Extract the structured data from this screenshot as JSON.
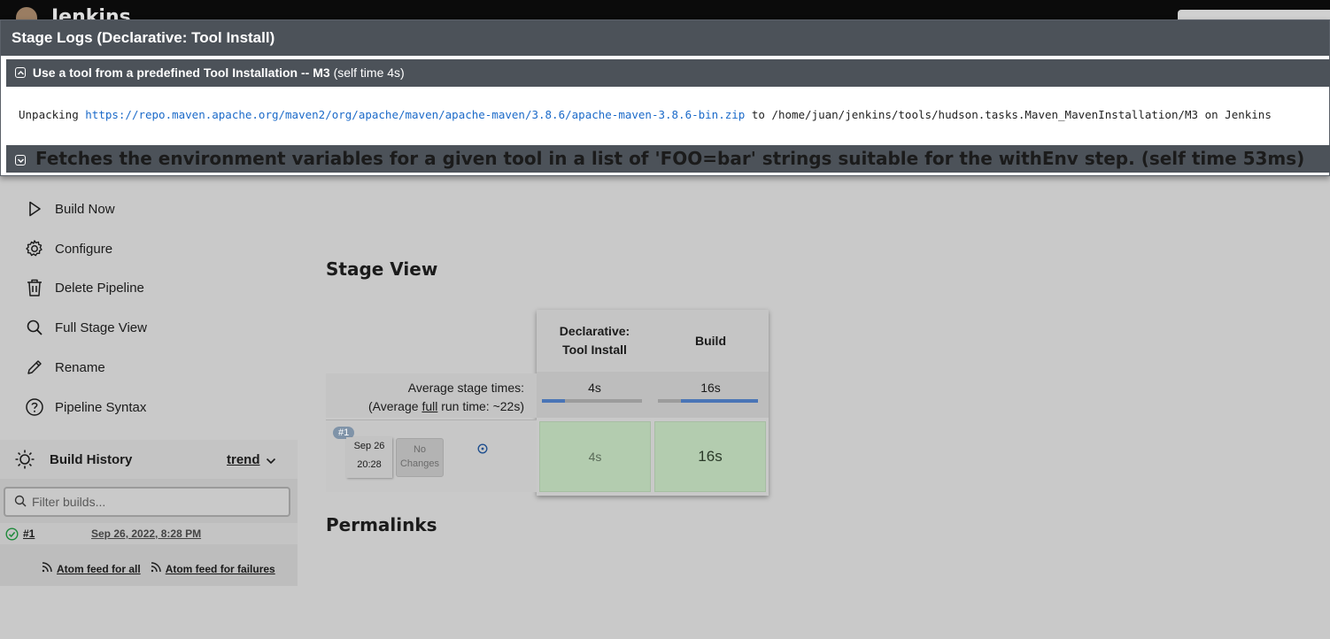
{
  "header": {
    "brand": "Jenkins"
  },
  "modal": {
    "title": "Stage Logs (Declarative: Tool Install)",
    "steps": [
      {
        "title": "Use a tool from a predefined Tool Installation -- M3",
        "time": "(self time 4s)",
        "expanded": true
      },
      {
        "title": "Fetches the environment variables for a given tool in a list of 'FOO=bar' strings suitable for the withEnv step.",
        "time": "(self time 53ms)",
        "expanded": false
      }
    ],
    "log": {
      "prefix": "Unpacking",
      "url": "https://repo.maven.apache.org/maven2/org/apache/maven/apache-maven/3.8.6/apache-maven-3.8.6-bin.zip",
      "suffix": "to /home/juan/jenkins/tools/hudson.tasks.Maven_MavenInstallation/M3 on Jenkins"
    }
  },
  "sidebar": {
    "items": [
      {
        "label": "Build Now",
        "icon": "play-icon"
      },
      {
        "label": "Configure",
        "icon": "gear-icon"
      },
      {
        "label": "Delete Pipeline",
        "icon": "trash-icon"
      },
      {
        "label": "Full Stage View",
        "icon": "search-icon"
      },
      {
        "label": "Rename",
        "icon": "pencil-icon"
      },
      {
        "label": "Pipeline Syntax",
        "icon": "help-icon"
      }
    ]
  },
  "build_history": {
    "title": "Build History",
    "trend": "trend",
    "filter_placeholder": "Filter builds...",
    "builds": [
      {
        "number": "#1",
        "date": "Sep 26, 2022, 8:28 PM",
        "status": "success"
      }
    ],
    "feed_all": "Atom feed for all",
    "feed_failures": "Atom feed for failures"
  },
  "stage_view": {
    "heading": "Stage View",
    "avg_label": "Average stage times:",
    "avg_full_prefix": "(Average ",
    "avg_full_link": "full",
    "avg_full_suffix": " run time: ~22s)",
    "stages": [
      {
        "name_line1": "Declarative:",
        "name_line2": "Tool Install",
        "avg": "4s",
        "avg_fraction": 0.23,
        "avg_offset": 0.0,
        "run_time": "4s"
      },
      {
        "name_line1": "Build",
        "name_line2": "",
        "avg": "16s",
        "avg_fraction": 0.77,
        "avg_offset": 0.23,
        "run_time": "16s"
      }
    ],
    "run": {
      "badge": "#1",
      "date": "Sep 26",
      "time": "20:28",
      "changes_line1": "No",
      "changes_line2": "Changes"
    }
  },
  "permalinks": {
    "heading": "Permalinks"
  },
  "colors": {
    "accent": "#4a75b6",
    "success_cell": "#b3ccaf",
    "modal_header": "#4c5259",
    "link": "#1b6ac9"
  }
}
